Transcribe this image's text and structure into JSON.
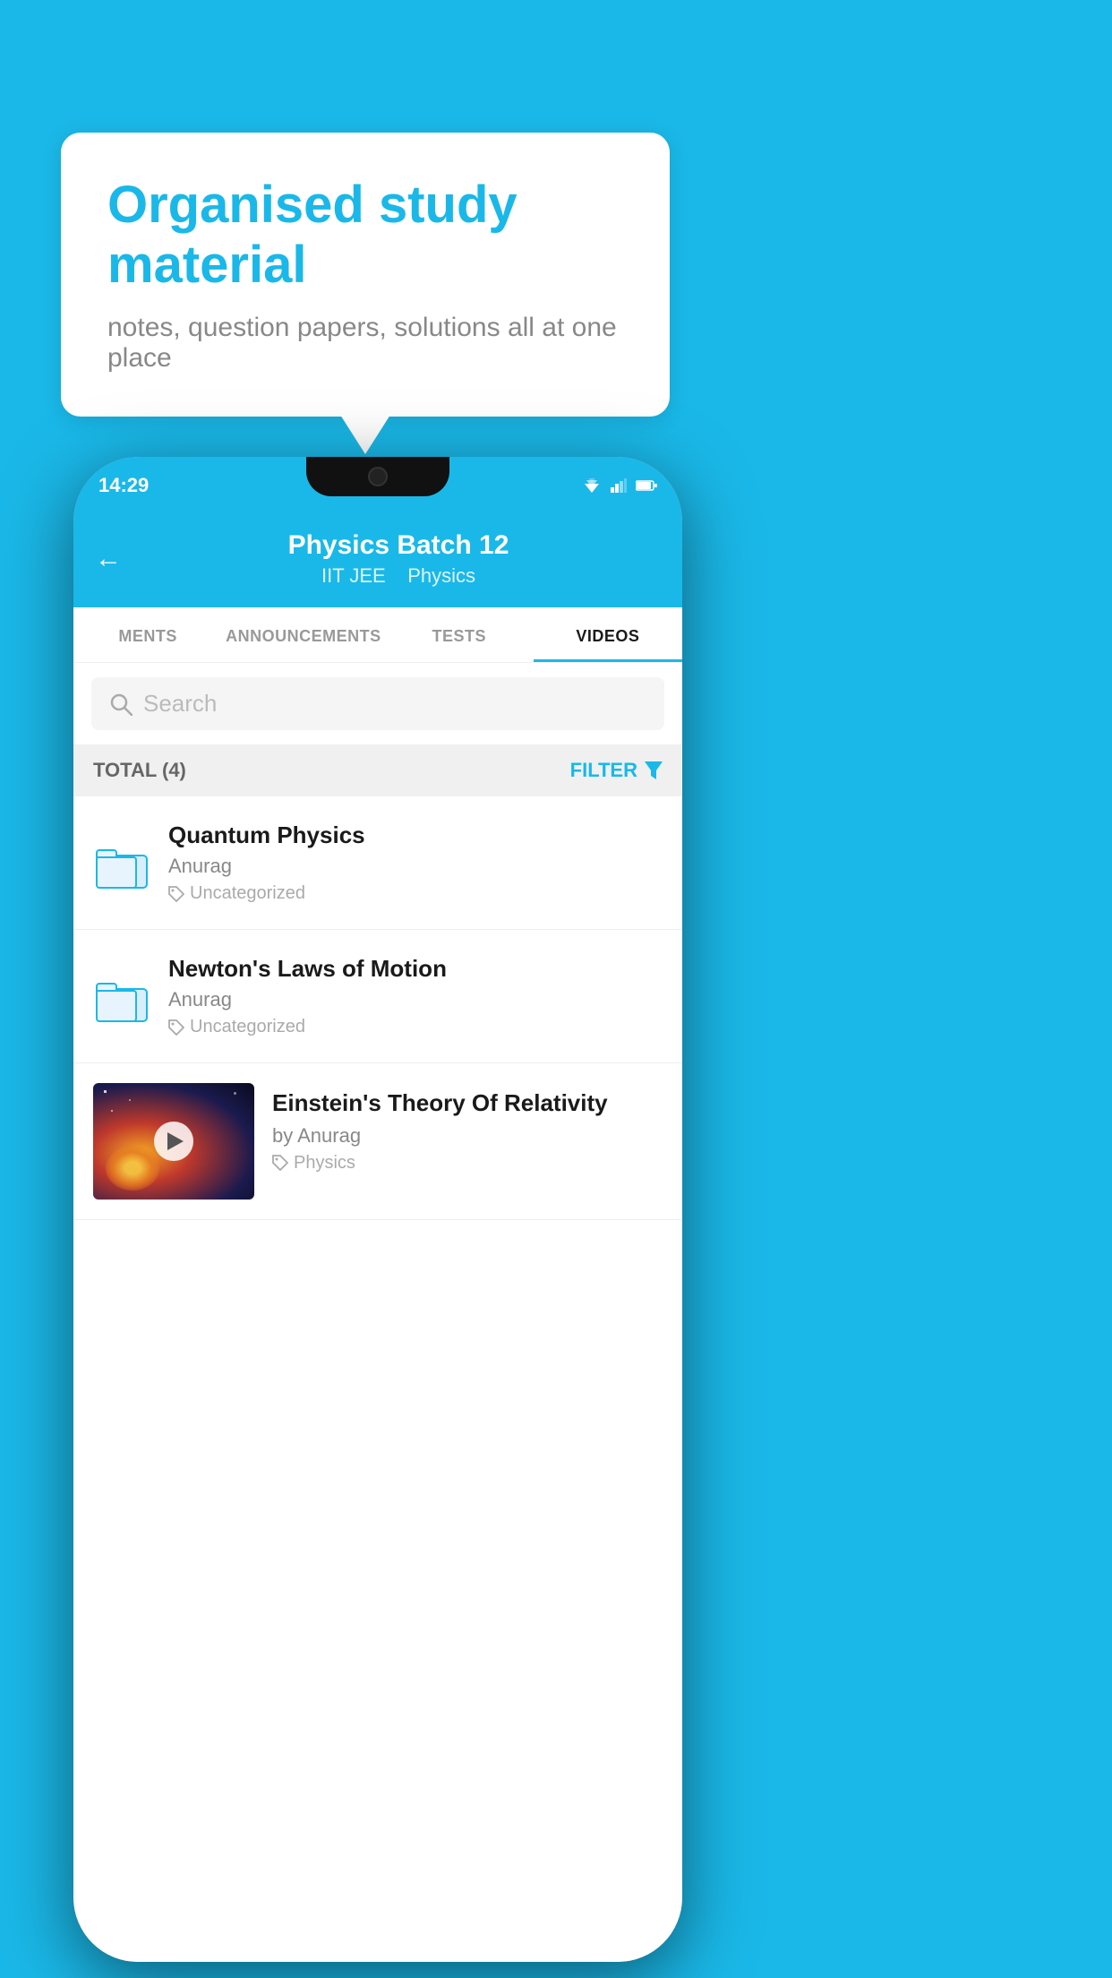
{
  "background": {
    "color": "#1ab8e8"
  },
  "bubble": {
    "title": "Organised study material",
    "subtitle": "notes, question papers, solutions all at one place"
  },
  "status_bar": {
    "time": "14:29",
    "wifi": "▲",
    "signal": "▲",
    "battery": "▮"
  },
  "header": {
    "back_label": "←",
    "title": "Physics Batch 12",
    "tag1": "IIT JEE",
    "tag2": "Physics"
  },
  "tabs": [
    {
      "label": "MENTS",
      "active": false
    },
    {
      "label": "ANNOUNCEMENTS",
      "active": false
    },
    {
      "label": "TESTS",
      "active": false
    },
    {
      "label": "VIDEOS",
      "active": true
    }
  ],
  "search": {
    "placeholder": "Search"
  },
  "filter": {
    "total_label": "TOTAL (4)",
    "filter_label": "FILTER"
  },
  "items": [
    {
      "title": "Quantum Physics",
      "author": "Anurag",
      "tag": "Uncategorized",
      "type": "folder"
    },
    {
      "title": "Newton's Laws of Motion",
      "author": "Anurag",
      "tag": "Uncategorized",
      "type": "folder"
    },
    {
      "title": "Einstein's Theory Of Relativity",
      "author": "by Anurag",
      "tag": "Physics",
      "type": "video"
    }
  ]
}
